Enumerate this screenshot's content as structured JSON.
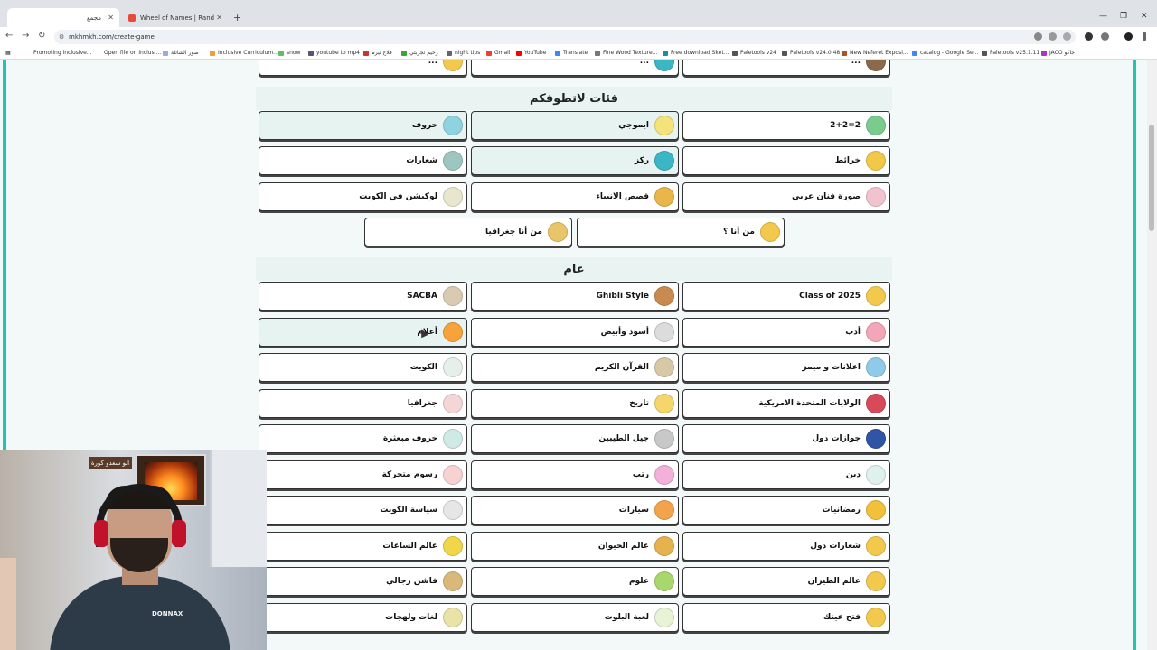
{
  "tabs": [
    {
      "title": "مجمع",
      "active": true
    },
    {
      "title": "Wheel of Names | Random nam",
      "active": false
    }
  ],
  "address_bar": {
    "url": "mkhmkh.com/create-game"
  },
  "bookmarks": [
    "Promoting inclusive...",
    "Open file on inclusi...",
    "صور الشائلة",
    "Inclusive Curriculum...",
    "snow",
    "youtube to mp4",
    "فلاح ثيرم",
    "زخيم تجربتي",
    "night tips",
    "Gmail",
    "YouTube",
    "Translate",
    "Fine Wood Texture...",
    "Free download Sket...",
    "Paletools v24",
    "Paletools v24.0.48",
    "New Neferet Exposi...",
    "catalog - Google Se...",
    "Paletools v25.1.11",
    "JACO جاكو"
  ],
  "sections": {
    "top_partial": [
      "...",
      "...",
      "..."
    ],
    "fun": {
      "title": "فئات لاتطوفكم",
      "items": [
        {
          "label": "حروف",
          "icon": "letters-icon",
          "color": "#8fd3e0"
        },
        {
          "label": "ايموجي",
          "icon": "emoji-icon",
          "color": "#f4e27a"
        },
        {
          "label": "2=2+2",
          "icon": "math-icon",
          "color": "#7acc8e"
        },
        {
          "label": "شعارات",
          "icon": "logo-icon",
          "color": "#9ec6c0"
        },
        {
          "label": "ركز",
          "icon": "focus-icon",
          "color": "#3bb6c4"
        },
        {
          "label": "خرائط",
          "icon": "map-icon",
          "color": "#f2c849"
        },
        {
          "label": "لوكيشن في الكويت",
          "icon": "location-icon",
          "color": "#e9e6ce"
        },
        {
          "label": "قصص الانبياء",
          "icon": "story-icon",
          "color": "#e8b64a"
        },
        {
          "label": "صورة فنان عربي",
          "icon": "artist-icon",
          "color": "#f1c3cf"
        },
        {
          "label": "من أنا جغرافيا",
          "icon": "globe-icon",
          "color": "#e9c56a"
        },
        {
          "label": "من أنا ؟",
          "icon": "silhouette-icon",
          "color": "#f2c94c"
        }
      ]
    },
    "general": {
      "title": "عام",
      "items": [
        {
          "label": "SACBA",
          "icon": "bank-icon",
          "color": "#d9cbb1"
        },
        {
          "label": "Ghibli Style",
          "icon": "portrait-icon",
          "color": "#c78b52"
        },
        {
          "label": "Class of 2025",
          "icon": "graduation-icon",
          "color": "#f2c94c"
        },
        {
          "label": "أعلام",
          "icon": "flag-icon",
          "color": "#f7a23a"
        },
        {
          "label": "أسود وأبيض",
          "icon": "glasses-icon",
          "color": "#dcdcdc"
        },
        {
          "label": "أدب",
          "icon": "book-icon",
          "color": "#f3a6b8"
        },
        {
          "label": "الكويت",
          "icon": "kuwait-icon",
          "color": "#e6efe9"
        },
        {
          "label": "القرآن الكريم",
          "icon": "quran-icon",
          "color": "#d8c9a6"
        },
        {
          "label": "اعلانات و ميمز",
          "icon": "tv-icon",
          "color": "#8fcbe8"
        },
        {
          "label": "جغرافيا",
          "icon": "pin-icon",
          "color": "#f4d6d6"
        },
        {
          "label": "تاريخ",
          "icon": "history-icon",
          "color": "#f4d66b"
        },
        {
          "label": "الولايات المتحدة الامريكية",
          "icon": "usa-flag-icon",
          "color": "#d84a5a"
        },
        {
          "label": "حروف مبعثرة",
          "icon": "scatter-icon",
          "color": "#cfe9e4"
        },
        {
          "label": "جيل الطيبين",
          "icon": "cassette-icon",
          "color": "#c8c8c8"
        },
        {
          "label": "جوازات دول",
          "icon": "passport-icon",
          "color": "#3055a5"
        },
        {
          "label": "رسوم متحركة",
          "icon": "cartoon-icon",
          "color": "#f6d2d2"
        },
        {
          "label": "رتب",
          "icon": "rank-icon",
          "color": "#f3b0d9"
        },
        {
          "label": "دين",
          "icon": "mosque-icon",
          "color": "#dff1ec"
        },
        {
          "label": "سياسة الكويت",
          "icon": "politics-icon",
          "color": "#e6e6e6"
        },
        {
          "label": "سيارات",
          "icon": "car-icon",
          "color": "#f2a34b"
        },
        {
          "label": "رمضانيات",
          "icon": "ramadan-icon",
          "color": "#f2c03b"
        },
        {
          "label": "عالم الساعات",
          "icon": "watch-icon",
          "color": "#f2d64a"
        },
        {
          "label": "عالم الحيوان",
          "icon": "animal-icon",
          "color": "#e6b24d"
        },
        {
          "label": "شعارات دول",
          "icon": "emblem-icon",
          "color": "#f2c94c"
        },
        {
          "label": "فاشن رجالي",
          "icon": "fashion-icon",
          "color": "#d9b979"
        },
        {
          "label": "علوم",
          "icon": "science-icon",
          "color": "#a8d86b"
        },
        {
          "label": "عالم الطيران",
          "icon": "plane-icon",
          "color": "#f2c94c"
        },
        {
          "label": "لغات ولهجات",
          "icon": "languages-icon",
          "color": "#e9e3a8"
        },
        {
          "label": "لعبة البلوت",
          "icon": "cards-icon",
          "color": "#e8f3d6"
        },
        {
          "label": "فتح عينك",
          "icon": "eye-icon",
          "color": "#f2c94c"
        }
      ]
    }
  },
  "webcam": {
    "sign_text": "ابو سعدو كورة",
    "shirt_text": "DONNAX"
  },
  "colors": {
    "accent": "#22c3b0",
    "header_bg": "#e9f4f2"
  }
}
